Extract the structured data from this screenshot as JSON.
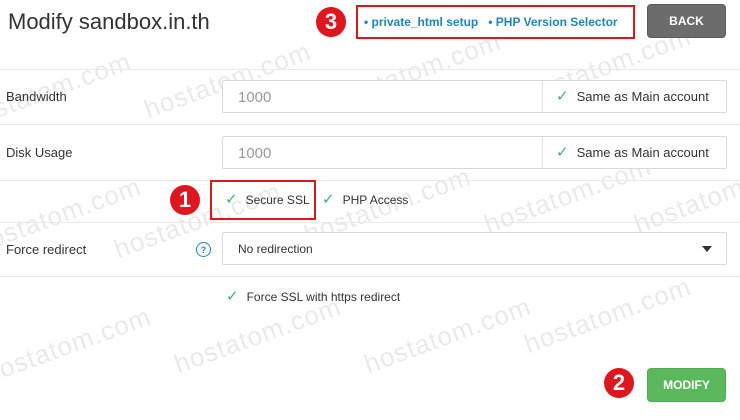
{
  "page": {
    "title": "Modify sandbox.in.th"
  },
  "header_links": [
    {
      "label": "• private_html setup"
    },
    {
      "label": "• PHP Version Selector"
    }
  ],
  "buttons": {
    "back_label": "BACK",
    "modify_label": "MODIFY"
  },
  "form": {
    "bandwidth": {
      "label": "Bandwidth",
      "value": "1000",
      "same_as_main_label": "Same as Main account",
      "same_as_main_checked": true
    },
    "disk_usage": {
      "label": "Disk Usage",
      "value": "1000",
      "same_as_main_label": "Same as Main account",
      "same_as_main_checked": true
    },
    "secure_ssl": {
      "label": "Secure SSL",
      "checked": true
    },
    "php_access": {
      "label": "PHP Access",
      "checked": true
    },
    "force_redirect": {
      "label": "Force redirect",
      "help_icon": "?",
      "selected": "No redirection"
    },
    "force_ssl": {
      "label": "Force SSL with https redirect",
      "checked": true
    }
  },
  "annotations": {
    "marker_1": "1",
    "marker_2": "2",
    "marker_3": "3"
  },
  "watermark_text": "hostatom.com",
  "colors": {
    "accent_link": "#1f86b6",
    "check_green": "#3cb371",
    "modify_button": "#5cb85c",
    "back_button": "#6c6c6c",
    "highlight_red": "#e0161f"
  },
  "icons": {
    "checkbox": "check-icon",
    "help": "help-circle-icon",
    "dropdown": "caret-down-icon"
  }
}
